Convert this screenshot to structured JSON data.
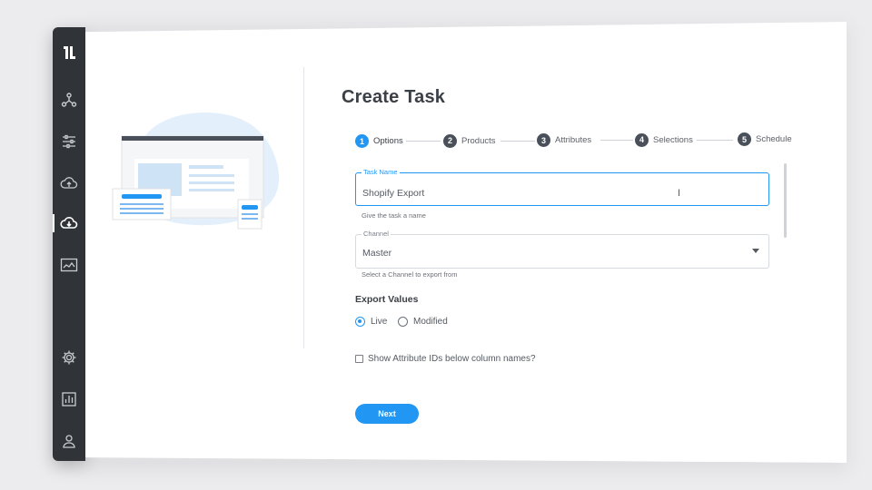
{
  "sidebar": {
    "items": [
      {
        "icon": "brand-logo-icon"
      },
      {
        "icon": "network-icon"
      },
      {
        "icon": "sliders-icon"
      },
      {
        "icon": "cloud-upload-icon"
      },
      {
        "icon": "cloud-download-icon",
        "active": true
      },
      {
        "icon": "image-chart-icon"
      },
      {
        "icon": "gear-icon"
      },
      {
        "icon": "report-icon"
      },
      {
        "icon": "user-icon"
      }
    ]
  },
  "main": {
    "title": "Create Task",
    "steps": [
      {
        "num": "1",
        "label": "Options",
        "active": true
      },
      {
        "num": "2",
        "label": "Products"
      },
      {
        "num": "3",
        "label": "Attributes"
      },
      {
        "num": "4",
        "label": "Selections"
      },
      {
        "num": "5",
        "label": "Schedule"
      }
    ],
    "task_name": {
      "label": "Task Name",
      "value": "Shopify Export",
      "helper": "Give the task a name"
    },
    "channel": {
      "label": "Channel",
      "value": "Master",
      "helper": "Select a Channel to export from"
    },
    "export_values": {
      "title": "Export Values",
      "options": [
        {
          "label": "Live",
          "checked": true
        },
        {
          "label": "Modified",
          "checked": false
        }
      ]
    },
    "checkbox_label": "Show Attribute IDs below column names?",
    "next_label": "Next"
  },
  "colors": {
    "accent": "#2196f3",
    "sidebar": "#303438"
  }
}
